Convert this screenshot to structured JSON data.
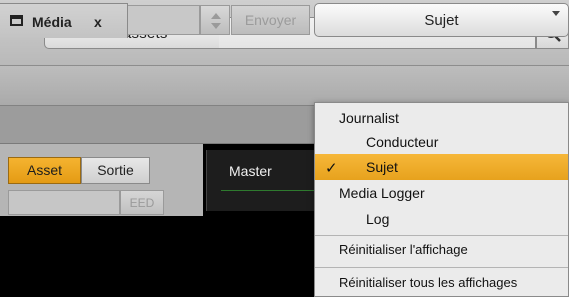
{
  "search": {
    "scope_label": "Tous les assets",
    "query": "",
    "search_icon": "magnifier-icon"
  },
  "toolbar": {
    "send_label": "Envoyer",
    "view_selector": "Sujet"
  },
  "tabs": [
    {
      "label": "Média",
      "close": "x"
    }
  ],
  "segments": {
    "asset": "Asset",
    "sortie": "Sortie"
  },
  "eed_label": "EED",
  "master_label": "Master",
  "menu": {
    "group1": "Journalist",
    "item1": "Conducteur",
    "item2": "Sujet",
    "item2_check": "✓",
    "group2": "Media Logger",
    "item3": "Log",
    "reset_view": "Réinitialiser l'affichage",
    "reset_all": "Réinitialiser tous les affichages"
  },
  "colors": {
    "accent": "#f0a828",
    "panel_bg": "#000000"
  }
}
